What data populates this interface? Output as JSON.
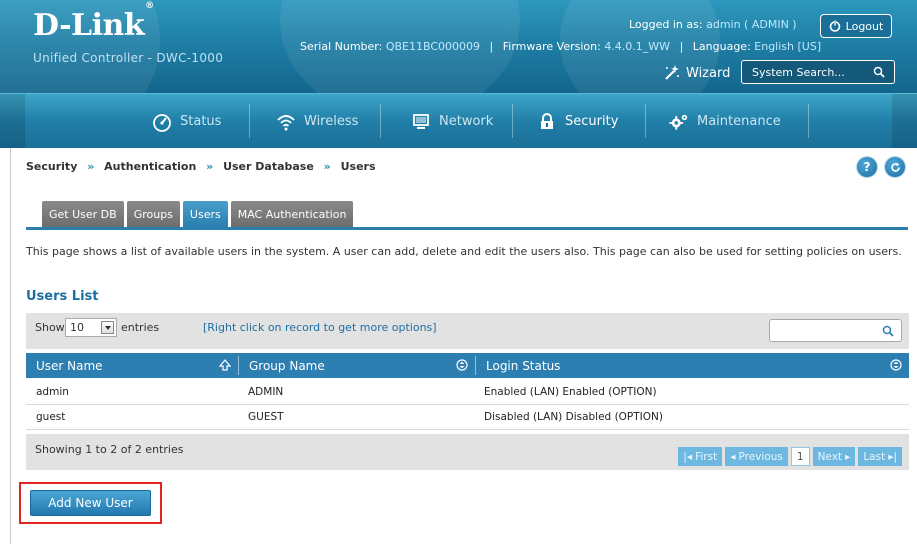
{
  "header": {
    "brand": "D-Link",
    "brand_mark": "®",
    "product": "Unified Controller - DWC-1000",
    "serial_label": "Serial Number:",
    "serial_value": "QBE11BC000009",
    "firmware_label": "Firmware Version:",
    "firmware_value": "4.4.0.1_WW",
    "language_label": "Language:",
    "language_value": "English [US]",
    "logged_label": "Logged in as:",
    "logged_value": "admin ( ADMIN )",
    "logout_label": "Logout",
    "wizard_label": "Wizard",
    "system_search_placeholder": "System Search..."
  },
  "nav": {
    "items": [
      {
        "label": "Status",
        "icon": "gauge-icon"
      },
      {
        "label": "Wireless",
        "icon": "wifi-icon"
      },
      {
        "label": "Network",
        "icon": "monitor-icon"
      },
      {
        "label": "Security",
        "icon": "lock-icon"
      },
      {
        "label": "Maintenance",
        "icon": "gears-icon"
      }
    ],
    "active_index": 3
  },
  "breadcrumb": {
    "items": [
      "Security",
      "Authentication",
      "User Database",
      "Users"
    ],
    "separator": "»"
  },
  "help_buttons": {
    "help": "?",
    "refresh_icon": "refresh-icon"
  },
  "tabs": {
    "items": [
      "Get User DB",
      "Groups",
      "Users",
      "MAC Authentication"
    ],
    "active_index": 2
  },
  "description": "This page shows a list of available users in the system. A user can add, delete and edit the users also. This page can also be used for setting policies on users.",
  "list": {
    "title": "Users List",
    "show_label": "Show",
    "entries_value": "10",
    "entries_label": "entries",
    "hint": "[Right click on record to get more options]",
    "columns": [
      "User Name",
      "Group Name",
      "Login Status"
    ],
    "rows": [
      {
        "user": "admin",
        "group": "ADMIN",
        "status": "Enabled (LAN) Enabled (OPTION)"
      },
      {
        "user": "guest",
        "group": "GUEST",
        "status": "Disabled (LAN) Disabled (OPTION)"
      }
    ],
    "showing": "Showing 1 to 2 of 2 entries",
    "pager": {
      "first": "First",
      "previous": "Previous",
      "page": "1",
      "next": "Next",
      "last": "Last"
    }
  },
  "add_button": "Add New User",
  "colors": {
    "header_blue": "#1f7fa6",
    "nav_blue": "#217fa8",
    "table_header": "#2d7fb2",
    "active_tab": "#2a7fb0",
    "highlight_outline": "#e02424"
  }
}
